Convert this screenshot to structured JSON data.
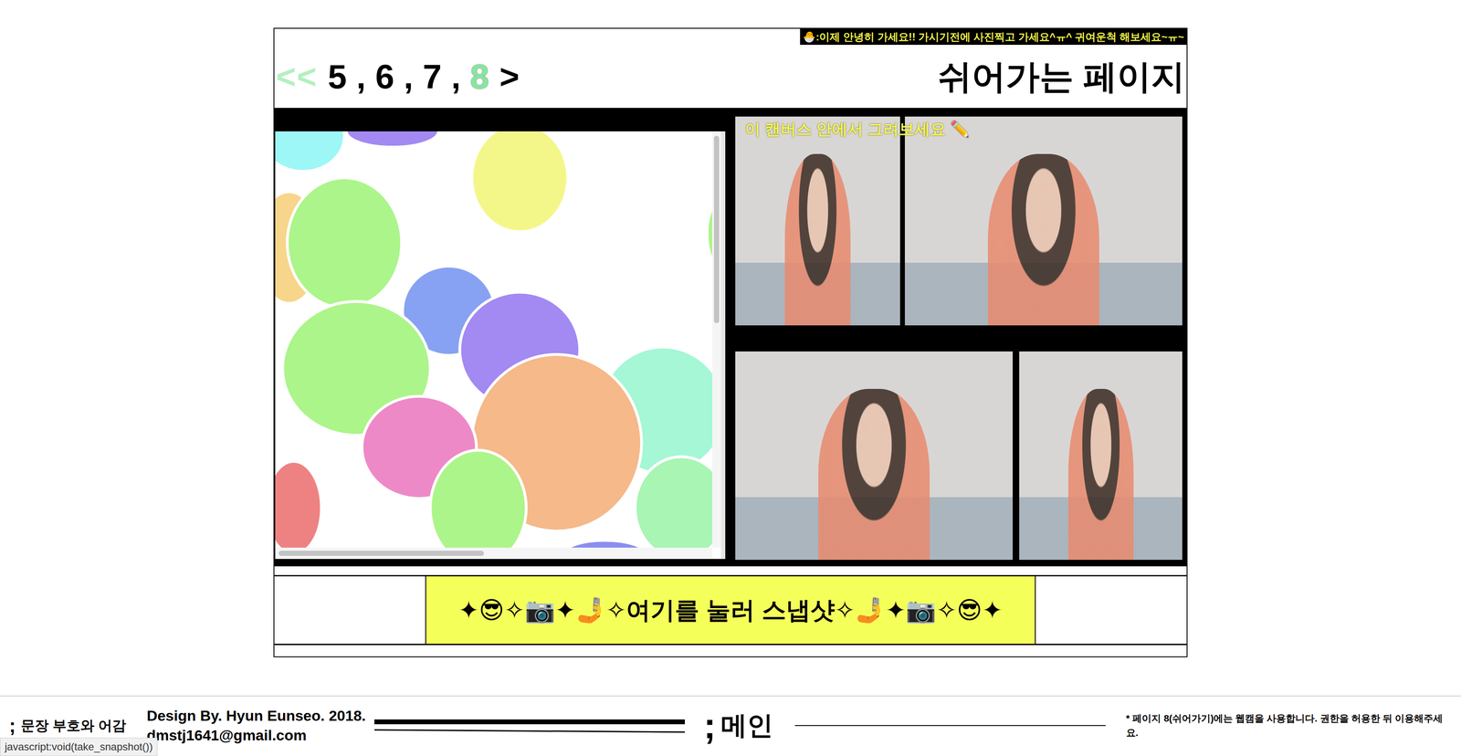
{
  "marquee": "🐣:이제 안녕히 가세요!! 가시기전에 사진찍고 가세요^ㅠ^ 귀여운척 해보세요~ㅠ~",
  "nav": {
    "prev": "<<",
    "separator": ",",
    "next": ">",
    "pages": [
      {
        "label": "5",
        "selected": false
      },
      {
        "label": "6",
        "selected": false
      },
      {
        "label": "7",
        "selected": false
      },
      {
        "label": "8",
        "selected": true
      }
    ]
  },
  "title": "쉬어가는 페이지",
  "hint": "이 캔버스 안에서 그려보세요 ✏️",
  "canvas": {
    "blobs": [
      {
        "color": "#9ef7f7"
      },
      {
        "color": "#a389f2"
      },
      {
        "color": "#f3f78a"
      },
      {
        "color": "#f7d58a"
      },
      {
        "color": "#acf58a"
      },
      {
        "color": "#acf58a"
      },
      {
        "color": "#87a2f2"
      },
      {
        "color": "#a389f2"
      },
      {
        "color": "#acf58a"
      },
      {
        "color": "#a5f7d5"
      },
      {
        "color": "#f5b98a"
      },
      {
        "color": "#ee89c8"
      },
      {
        "color": "#ee8282"
      },
      {
        "color": "#acf58a"
      },
      {
        "color": "#a8f5b4"
      },
      {
        "color": "#8a8ef0"
      }
    ],
    "scroll": {
      "vertical": {
        "level": 0.45
      },
      "horizontal": {
        "level": 0.47
      }
    }
  },
  "snapshot_button": "✦😎✧📷✦🤳✧여기를 눌러 스냅샷✧🤳✦📷✧😎✦",
  "footer": {
    "brand_mark": ";",
    "brand": "문장 부호와 어감",
    "credit": "Design By. Hyun Eunseo. 2018.",
    "email": "dmstj1641@gmail.com",
    "main_mark": ";",
    "main": "메인",
    "notice": "* 페이지 8(쉬어가기)에는 웹캠을 사용합니다. 권한을 허용한 뒤 이용해주세요."
  },
  "status_bar": "javascript:void(take_snapshot())"
}
